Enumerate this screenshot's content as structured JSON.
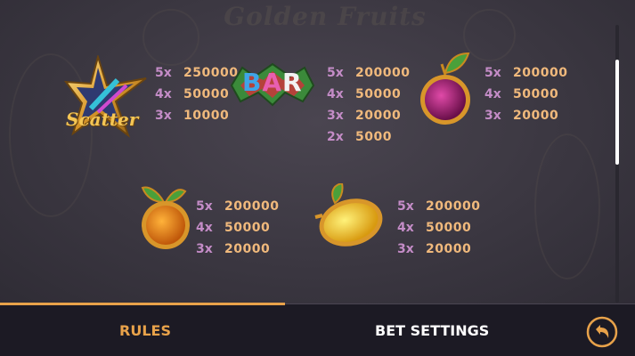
{
  "background": {
    "watermark_title": "Golden Fruits"
  },
  "symbols": [
    {
      "id": "scatter",
      "label": "Scatter",
      "icon": "scatter-star-icon",
      "pays": [
        {
          "mult": "5x",
          "amount": "250000"
        },
        {
          "mult": "4x",
          "amount": "50000"
        },
        {
          "mult": "3x",
          "amount": "10000"
        }
      ]
    },
    {
      "id": "bar",
      "label": "BAR",
      "icon": "bar-icon",
      "pays": [
        {
          "mult": "5x",
          "amount": "200000"
        },
        {
          "mult": "4x",
          "amount": "50000"
        },
        {
          "mult": "3x",
          "amount": "20000"
        },
        {
          "mult": "2x",
          "amount": "5000"
        }
      ]
    },
    {
      "id": "plum",
      "icon": "plum-icon",
      "pays": [
        {
          "mult": "5x",
          "amount": "200000"
        },
        {
          "mult": "4x",
          "amount": "50000"
        },
        {
          "mult": "3x",
          "amount": "20000"
        }
      ]
    },
    {
      "id": "orange",
      "icon": "orange-icon",
      "pays": [
        {
          "mult": "5x",
          "amount": "200000"
        },
        {
          "mult": "4x",
          "amount": "50000"
        },
        {
          "mult": "3x",
          "amount": "20000"
        }
      ]
    },
    {
      "id": "lemon",
      "icon": "lemon-icon",
      "pays": [
        {
          "mult": "5x",
          "amount": "200000"
        },
        {
          "mult": "4x",
          "amount": "50000"
        },
        {
          "mult": "3x",
          "amount": "20000"
        }
      ]
    }
  ],
  "tabs": {
    "rules": "RULES",
    "bet_settings": "BET SETTINGS",
    "active": "rules"
  },
  "colors": {
    "accent": "#e8a24a",
    "multiplier": "#c48cc7",
    "amount": "#f0b97c",
    "bar_bg": "#1c1a24"
  },
  "back_button": {
    "icon": "back-arrow-icon"
  },
  "scroll": {
    "position_fraction": 0.2
  }
}
